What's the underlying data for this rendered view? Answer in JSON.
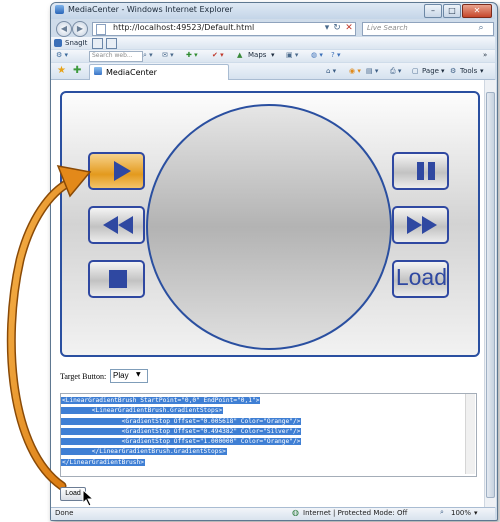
{
  "window": {
    "title": "MediaCenter - Windows Internet Explorer",
    "minimize_glyph": "–",
    "maximize_glyph": "□",
    "close_glyph": "✕"
  },
  "nav": {
    "address": "http://localhost:49523/Default.html",
    "search_placeholder": "Live Search"
  },
  "toolbar_snagit": {
    "label": "SnagIt"
  },
  "toolbar_links": {
    "search_placeholder": "Search web...",
    "maps_label": "Maps"
  },
  "tab": {
    "label": "MediaCenter"
  },
  "command_bar": {
    "page_label": "Page",
    "tools_label": "Tools"
  },
  "player": {
    "load_label": "Load"
  },
  "controls": {
    "target_label": "Target Button:",
    "target_value": "Play",
    "code_lines": [
      "<LinearGradientBrush StartPoint=\"0,0\" EndPoint=\"0,1\">",
      "        <LinearGradientBrush.GradientStops>",
      "                <GradientStop Offset=\"0.005618\" Color=\"Orange\"/>",
      "                <GradientStop Offset=\"0.494382\" Color=\"Silver\"/>",
      "                <GradientStop Offset=\"1.000000\" Color=\"Orange\"/>",
      "        </LinearGradientBrush.GradientStops>",
      "</LinearGradientBrush>"
    ],
    "load_button_label": "Load"
  },
  "statusbar": {
    "left_text": "Done",
    "zone_text": "Internet | Protected Mode: Off",
    "zoom_text": "100%"
  },
  "colors": {
    "accent_blue": "#2f48a1",
    "active_orange": "#e39a1e",
    "selection_blue": "#3f7fd4"
  },
  "icons": [
    "back-icon",
    "forward-icon",
    "refresh-icon",
    "stop-icon",
    "search-icon",
    "favorites-star-icon",
    "add-favorites-icon",
    "home-icon",
    "feeds-icon",
    "print-icon",
    "page-icon",
    "tools-icon",
    "play-icon",
    "pause-icon",
    "rewind-icon",
    "fast-forward-icon",
    "stop-square-icon",
    "mouse-cursor-icon",
    "globe-icon",
    "arrow-annotation"
  ]
}
